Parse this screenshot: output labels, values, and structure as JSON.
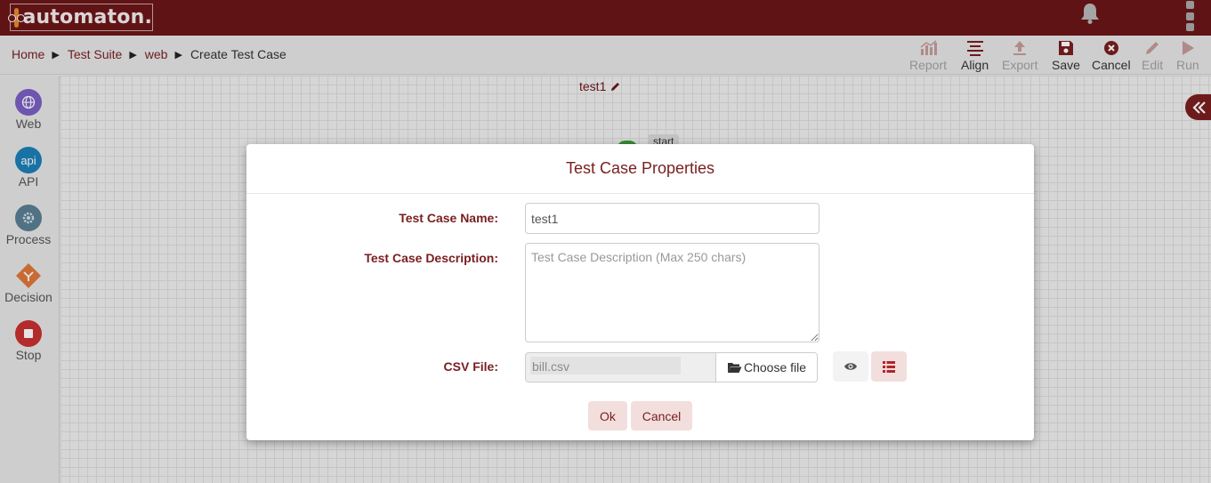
{
  "app": {
    "logo_text": "automaton."
  },
  "breadcrumb": {
    "items": [
      "Home",
      "Test Suite",
      "web"
    ],
    "current": "Create Test Case",
    "separator": "▶"
  },
  "toolbar": {
    "report": "Report",
    "align": "Align",
    "export": "Export",
    "save": "Save",
    "cancel": "Cancel",
    "edit": "Edit",
    "run": "Run"
  },
  "sidebar": {
    "items": [
      {
        "label": "Web",
        "icon": "globe-icon",
        "color": "#7b5fc4"
      },
      {
        "label": "API",
        "icon": "api-icon",
        "icon_text": "api",
        "color": "#1c7fb8"
      },
      {
        "label": "Process",
        "icon": "gear-icon",
        "color": "#5a7f93"
      },
      {
        "label": "Decision",
        "icon": "decision-icon",
        "color": "#e0763b"
      },
      {
        "label": "Stop",
        "icon": "stop-icon",
        "color": "#c8302f"
      }
    ]
  },
  "canvas": {
    "title": "test1",
    "start_label": "start"
  },
  "modal": {
    "title": "Test Case Properties",
    "name_label": "Test Case Name:",
    "name_value": "test1",
    "description_label": "Test Case Description:",
    "description_placeholder": "Test Case Description (Max 250 chars)",
    "csv_label": "CSV File:",
    "csv_file_name": "bill.csv",
    "choose_file_label": "Choose file",
    "ok_label": "Ok",
    "cancel_label": "Cancel"
  },
  "colors": {
    "brand": "#6b1618",
    "accent": "#7a1e20",
    "button_bg": "#f3dede"
  }
}
